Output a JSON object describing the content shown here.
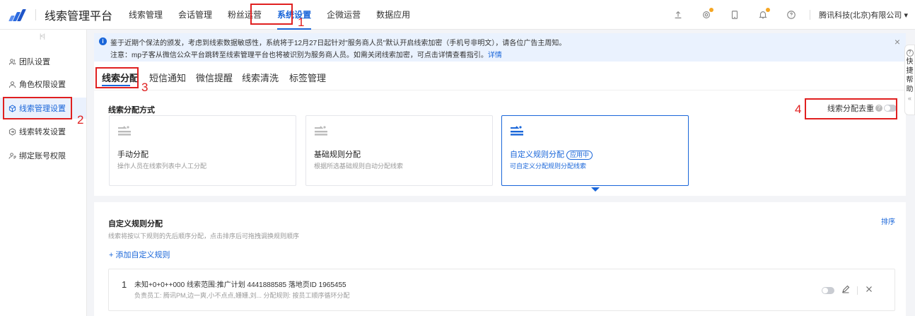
{
  "app": {
    "title": "线索管理平台",
    "nav": [
      "线索管理",
      "会话管理",
      "粉丝运营",
      "系统设置",
      "企微运营",
      "数据应用"
    ],
    "active_nav": "系统设置",
    "company": "腾讯科技(北京)有限公司 ▾"
  },
  "sidebar": {
    "items": [
      {
        "label": "团队设置",
        "icon": "team-icon"
      },
      {
        "label": "角色权限设置",
        "icon": "user-icon"
      },
      {
        "label": "线索管理设置",
        "icon": "cube-icon"
      },
      {
        "label": "线索转发设置",
        "icon": "forward-icon"
      },
      {
        "label": "绑定账号权限",
        "icon": "user-link-icon"
      }
    ],
    "active": "线索管理设置"
  },
  "notice": {
    "line1": "鉴于近期个保法的颁发，考虑到线索数据敏感性，系统将于12月27日起针对\"服务商人员\"默认开启线索加密（手机号非明文），请各位广告主周知。",
    "line2": "注意：mp子客从微信公众平台跳转至线索管理平台也将被识别为服务商人员。如需关闭线索加密，可点击详情查看指引。",
    "link": "详情"
  },
  "tabs": [
    "线索分配",
    "短信通知",
    "微信提醒",
    "线索清洗",
    "标签管理"
  ],
  "active_tab": "线索分配",
  "distribution": {
    "title": "线索分配方式",
    "dedupe_label": "线索分配去重",
    "methods": [
      {
        "name": "手动分配",
        "desc": "操作人员在线索列表中人工分配",
        "badge": ""
      },
      {
        "name": "基础规则分配",
        "desc": "根据所选基础规则自动分配线索",
        "badge": ""
      },
      {
        "name": "自定义规则分配",
        "desc": "可自定义分配规则分配线索",
        "badge": "应用中"
      }
    ]
  },
  "rules": {
    "title": "自定义规则分配",
    "subtitle": "线索将按以下规则的先后顺序分配，点击排序后可拖拽调换规则顺序",
    "sort_label": "排序",
    "add_label": "+ 添加自定义规则",
    "items": [
      {
        "index": "1",
        "main": "未知+0+0++000 线索范围:推广计划 4441888585 落地页ID 1965455",
        "sub": "负责员工: 腾讯PM,边一爽,小不点点,姗姗,刘...     分配规则: 按员工顺序循环分配"
      }
    ]
  },
  "annotations": [
    "1",
    "2",
    "3",
    "4"
  ],
  "helper": {
    "chars": [
      "快",
      "捷",
      "帮",
      "助"
    ],
    "chevron": "«"
  },
  "colors": {
    "accent": "#1a66d9",
    "annotation": "#e02020"
  }
}
